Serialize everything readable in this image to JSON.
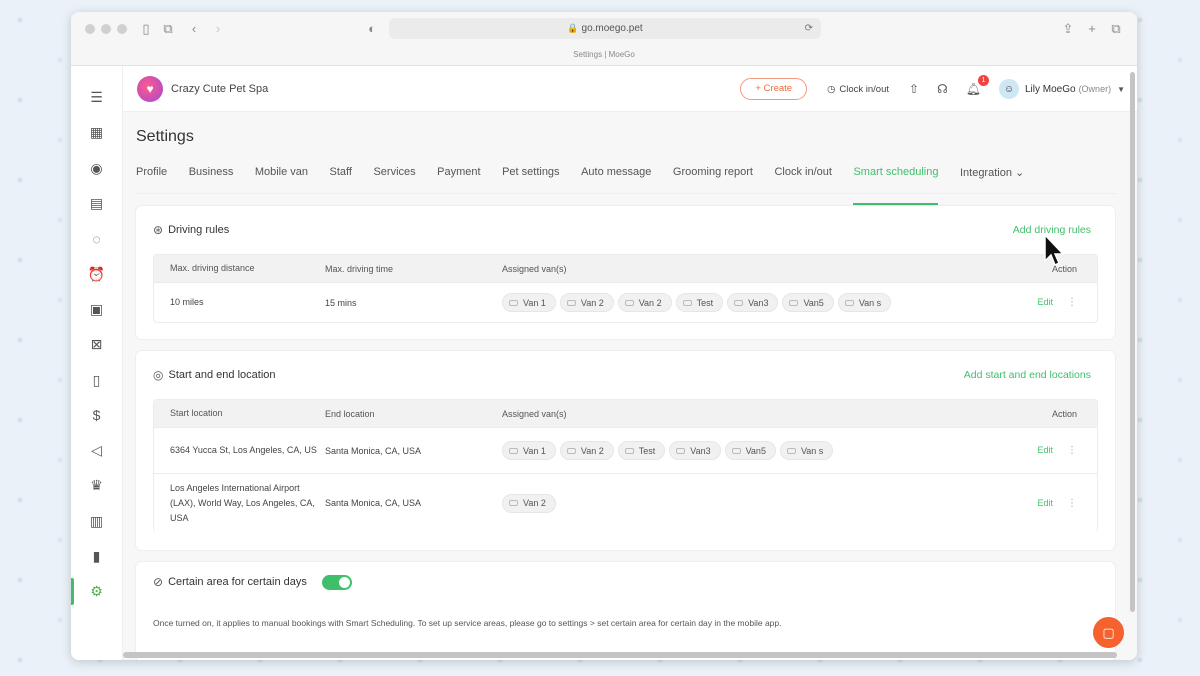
{
  "browser": {
    "url": "go.moego.pet",
    "tab_title": "Settings | MoeGo"
  },
  "header": {
    "business_name": "Crazy Cute Pet Spa",
    "create_label": "+ Create",
    "clock_label": "Clock in/out",
    "notification_count": "1",
    "user_name": "Lily MoeGo",
    "user_role": "(Owner)"
  },
  "page": {
    "title": "Settings",
    "tabs": [
      {
        "label": "Profile"
      },
      {
        "label": "Business"
      },
      {
        "label": "Mobile van"
      },
      {
        "label": "Staff"
      },
      {
        "label": "Services"
      },
      {
        "label": "Payment"
      },
      {
        "label": "Pet settings"
      },
      {
        "label": "Auto message"
      },
      {
        "label": "Grooming report"
      },
      {
        "label": "Clock in/out"
      },
      {
        "label": "Smart scheduling"
      },
      {
        "label": "Integration ⌄"
      }
    ],
    "active_tab": "Smart scheduling"
  },
  "driving_rules": {
    "title": "Driving rules",
    "add_label": "Add driving rules",
    "columns": [
      "Max. driving distance",
      "Max. driving time",
      "Assigned van(s)",
      "Action"
    ],
    "rows": [
      {
        "distance": "10 miles",
        "time": "15 mins",
        "vans": [
          "Van 1",
          "Van 2",
          "Van 2",
          "Test",
          "Van3",
          "Van5",
          "Van s"
        ],
        "edit": "Edit"
      }
    ]
  },
  "locations": {
    "title": "Start and end location",
    "add_label": "Add start and end locations",
    "columns": [
      "Start location",
      "End location",
      "Assigned van(s)",
      "Action"
    ],
    "rows": [
      {
        "start": "6364 Yucca St, Los Angeles, CA, US",
        "end": "Santa Monica, CA, USA",
        "vans": [
          "Van 1",
          "Van 2",
          "Test",
          "Van3",
          "Van5",
          "Van s"
        ],
        "edit": "Edit"
      },
      {
        "start": "Los Angeles International Airport (LAX), World Way, Los Angeles, CA, USA",
        "end": "Santa Monica, CA, USA",
        "vans": [
          "Van 2"
        ],
        "edit": "Edit"
      }
    ]
  },
  "certain_area": {
    "title": "Certain area for certain days",
    "enabled": true,
    "note": "Once turned on, it applies to manual bookings with Smart Scheduling. To set up service areas, please go to settings > set certain area for certain day in the mobile app."
  },
  "colors": {
    "accent": "#3fbf6c",
    "create": "#f06b3f",
    "fab": "#f5622d"
  }
}
